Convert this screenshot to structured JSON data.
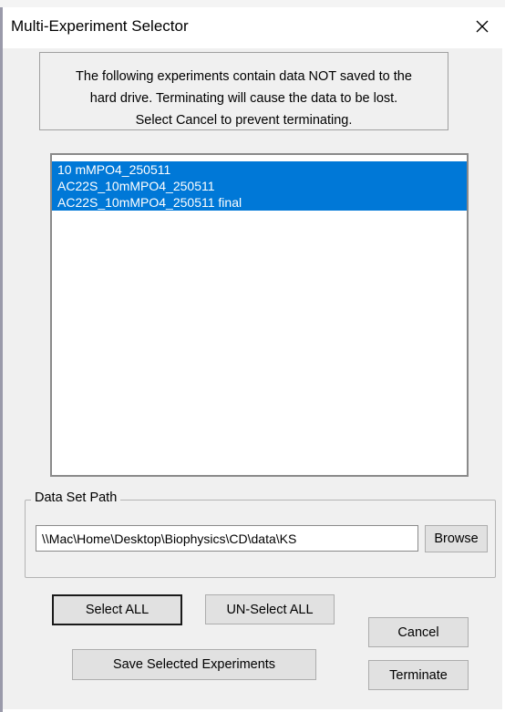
{
  "window": {
    "title": "Multi-Experiment Selector",
    "close_icon": "close-icon"
  },
  "message": {
    "lines": [
      "The following experiments contain data NOT saved to the",
      "hard drive. Terminating will cause the data to be lost.",
      "Select Cancel to prevent terminating."
    ]
  },
  "experiments": {
    "items": [
      {
        "label": "10 mMPO4_250511",
        "selected": true
      },
      {
        "label": "AC22S_10mMPO4_250511",
        "selected": true
      },
      {
        "label": "AC22S_10mMPO4_250511 final",
        "selected": true
      }
    ],
    "selection_color": "#0078d7"
  },
  "data_set_path": {
    "label": "Data Set Path",
    "value": "\\\\Mac\\Home\\Desktop\\Biophysics\\CD\\data\\KS",
    "browse_label": "Browse"
  },
  "buttons": {
    "select_all": "Select ALL",
    "unselect_all": "UN-Select ALL",
    "save_selected": "Save Selected Experiments",
    "cancel": "Cancel",
    "terminate": "Terminate"
  }
}
